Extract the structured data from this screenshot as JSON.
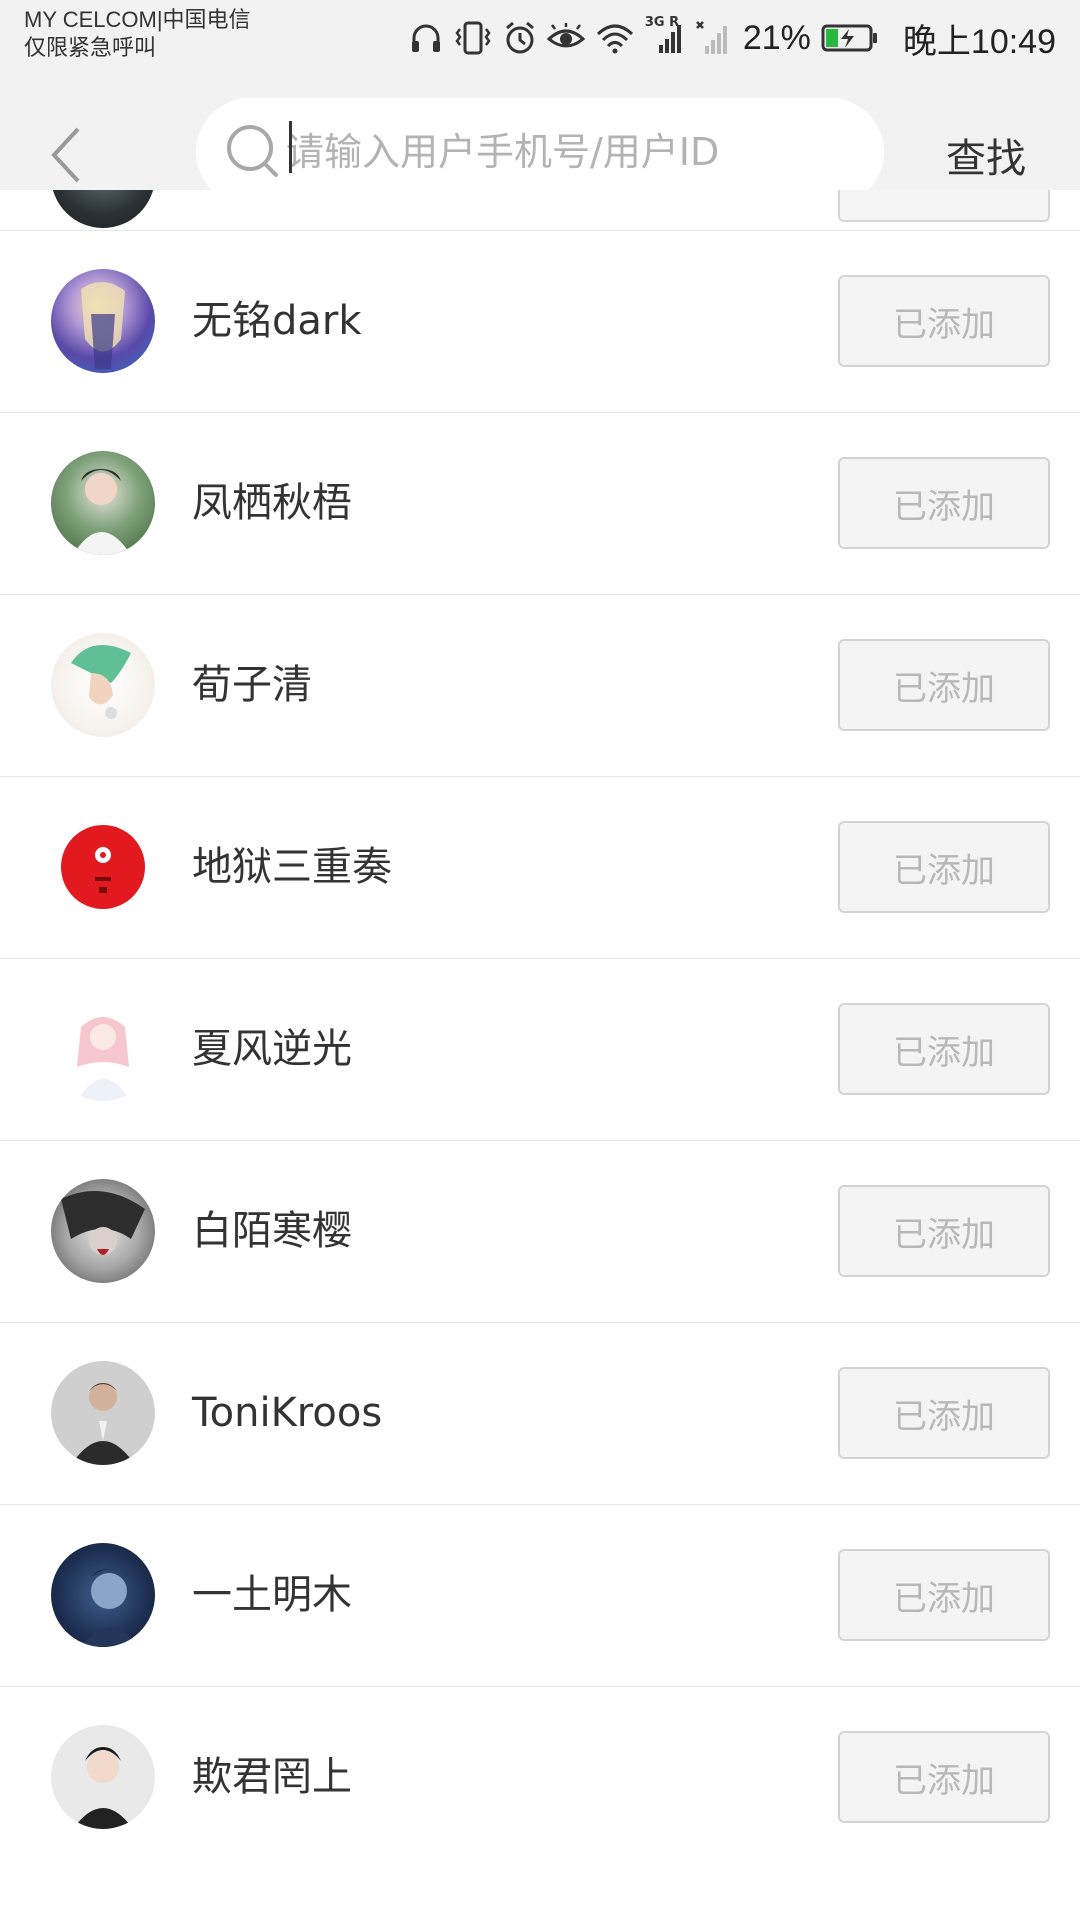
{
  "status_bar": {
    "carrier_line1": "MY CELCOM|中国电信",
    "carrier_line2": "仅限紧急呼叫",
    "network_label": "3G R",
    "battery_percent": "21%",
    "time": "晚上10:49",
    "icons": [
      "headphones-icon",
      "vibrate-icon",
      "alarm-icon",
      "eye-comfort-icon",
      "wifi-icon",
      "signal-icon",
      "no-signal-icon",
      "battery-charging-icon"
    ]
  },
  "header": {
    "back_icon": "chevron-left-icon",
    "search": {
      "placeholder": "请输入用户手机号/用户ID",
      "value": ""
    },
    "search_button": "查找"
  },
  "list": {
    "items": [
      {
        "name": "无铭dark",
        "status": "已添加"
      },
      {
        "name": "凤栖秋梧",
        "status": "已添加"
      },
      {
        "name": "荀子清",
        "status": "已添加"
      },
      {
        "name": "地狱三重奏",
        "status": "已添加"
      },
      {
        "name": "夏风逆光",
        "status": "已添加"
      },
      {
        "name": "白陌寒樱",
        "status": "已添加"
      },
      {
        "name": "ToniKroos",
        "status": "已添加"
      },
      {
        "name": "一土明木",
        "status": "已添加"
      },
      {
        "name": "欺君罔上",
        "status": "已添加"
      }
    ]
  },
  "colors": {
    "header_bg": "#f2f2f2",
    "button_border": "#d3d3d3",
    "button_text": "#b8b8b8",
    "text": "#333333"
  }
}
